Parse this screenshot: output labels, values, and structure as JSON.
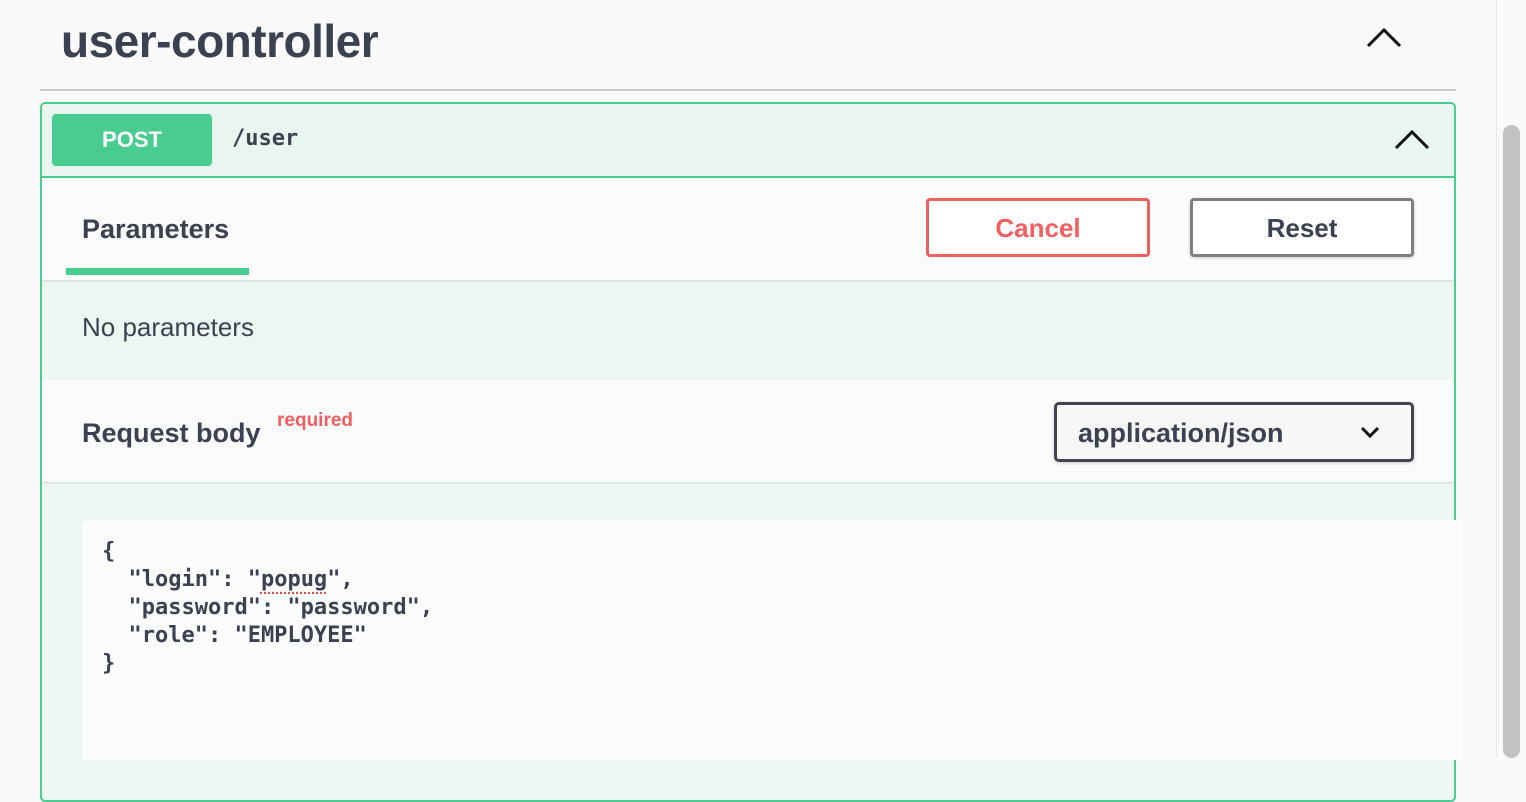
{
  "tag": {
    "title": "user-controller",
    "collapse_icon": "chevron-up-icon"
  },
  "operation": {
    "method": "POST",
    "path": "/user",
    "collapse_icon": "chevron-up-icon",
    "colors": {
      "accent": "#49cc90",
      "background": "#ebf7f0",
      "danger": "#f06060"
    }
  },
  "parameters": {
    "tab_label": "Parameters",
    "cancel_label": "Cancel",
    "reset_label": "Reset",
    "empty_text": "No parameters"
  },
  "request_body": {
    "title": "Request body",
    "required_label": "required",
    "content_type": "application/json",
    "dropdown_icon": "chevron-down-icon",
    "lines": [
      "{",
      "  \"login\": \"",
      "popug",
      "\",",
      "  \"password\": \"password\",",
      "  \"role\": \"EMPLOYEE\"",
      "}"
    ]
  }
}
